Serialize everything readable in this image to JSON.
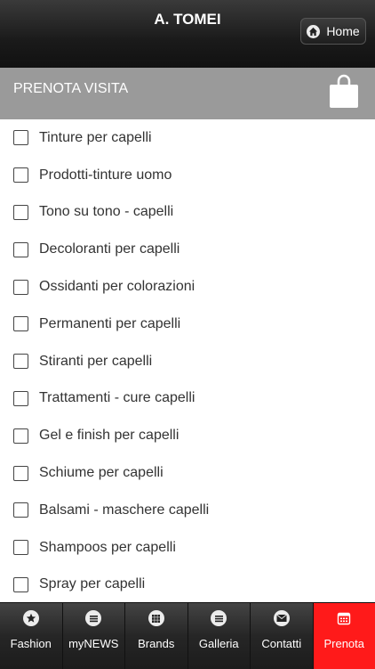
{
  "header": {
    "title": "A. TOMEI",
    "home_label": "Home"
  },
  "section": {
    "title": "PRENOTA VISITA"
  },
  "items": [
    "Tinture per capelli",
    "Prodotti-tinture uomo",
    "Tono su tono - capelli",
    "Decoloranti per capelli",
    "Ossidanti per colorazioni",
    "Permanenti per capelli",
    "Stiranti per capelli",
    "Trattamenti - cure capelli",
    "Gel e finish per capelli",
    "Schiume per capelli",
    "Balsami - maschere capelli",
    "Shampoos per capelli",
    "Spray per capelli"
  ],
  "tabs": [
    {
      "label": "Fashion",
      "icon": "star-icon"
    },
    {
      "label": "myNEWS",
      "icon": "list-icon"
    },
    {
      "label": "Brands",
      "icon": "grid-icon"
    },
    {
      "label": "Galleria",
      "icon": "list-icon"
    },
    {
      "label": "Contatti",
      "icon": "mail-icon"
    },
    {
      "label": "Prenota",
      "icon": "calendar-icon",
      "active": true
    }
  ],
  "colors": {
    "active_tab": "#ff1a1a",
    "section_bar": "#9a9a9a",
    "header": "#1a1a1a"
  }
}
